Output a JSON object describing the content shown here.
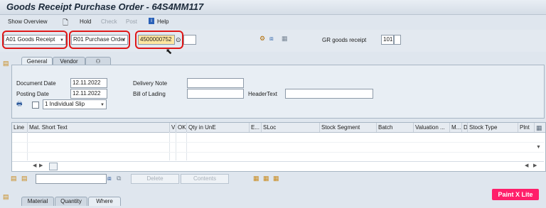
{
  "window": {
    "title": "Goods Receipt Purchase Order - 64S4MM117"
  },
  "toolbar": {
    "show_overview": "Show Overview",
    "hold": "Hold",
    "check": "Check",
    "post": "Post",
    "help": "Help"
  },
  "header": {
    "action_value": "A01 Goods Receipt",
    "reference_value": "R01 Purchase Order",
    "po_number": "4500000752",
    "gr_label": "GR goods receipt",
    "movement_type": "101"
  },
  "tabs": {
    "general": "General",
    "vendor": "Vendor"
  },
  "general": {
    "document_date_label": "Document Date",
    "document_date": "12.11.2022",
    "posting_date_label": "Posting Date",
    "posting_date": "12.11.2022",
    "delivery_note_label": "Delivery Note",
    "bill_of_lading_label": "Bill of Lading",
    "header_text_label": "HeaderText",
    "slip_value": "1 Individual Slip"
  },
  "grid": {
    "columns": [
      "Line",
      "Mat. Short Text",
      "V",
      "OK",
      "Qty in UnE",
      "E...",
      "SLoc",
      "Stock Segment",
      "Batch",
      "Valuation ...",
      "M...",
      "D",
      "Stock Type",
      "Plnt"
    ]
  },
  "bottom": {
    "delete": "Delete",
    "contents": "Contents"
  },
  "detail_tabs": {
    "material": "Material",
    "quantity": "Quantity",
    "where": "Where"
  },
  "badge": "Paint X Lite"
}
